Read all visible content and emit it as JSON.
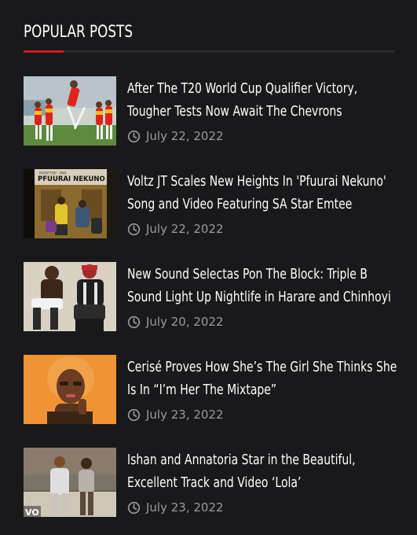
{
  "widget": {
    "title": "POPULAR POSTS",
    "accent_color": "#d41b1b"
  },
  "posts": [
    {
      "title_line1": "After The T20 World Cup Qualifier Victory,",
      "title_line2": "Tougher Tests Now Await The Chevrons",
      "date": "July 22, 2022",
      "thumbnail_icon": "cricket-team-photo"
    },
    {
      "title_line1": "Voltz JT Scales New Heights In 'Pfuurai Nekuno'",
      "title_line2": "Song and Video Featuring SA Star Emtee",
      "date": "July 22, 2022",
      "thumbnail_icon": "music-video-still",
      "thumbnail_text": "PFUURAI NEKUNO"
    },
    {
      "title_line1": "New Sound Selectas Pon The Block: Triple B",
      "title_line2": "Sound Light Up Nightlife in Harare and Chinhoyi",
      "date": "July 20, 2022",
      "thumbnail_icon": "artists-photo"
    },
    {
      "title_line1": "Cerisé Proves How She’s The Girl She Thinks She",
      "title_line2": "Is In “I’m Her The Mixtape”",
      "date": "July 23, 2022",
      "thumbnail_icon": "artist-portrait"
    },
    {
      "title_line1": "Ishan and Annatoria Star in the Beautiful,",
      "title_line2": "Excellent Track and Video ‘Lola’",
      "date": "July 23, 2022",
      "thumbnail_icon": "music-video-still",
      "thumbnail_text": "VO"
    }
  ]
}
